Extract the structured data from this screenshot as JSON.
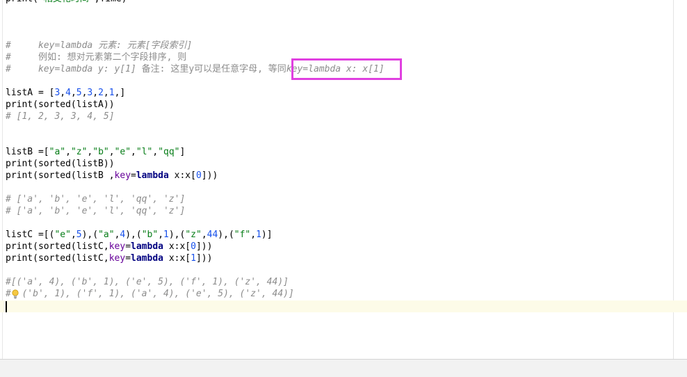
{
  "editor": {
    "lines": [
      {
        "id": "l0",
        "parts": [
          {
            "t": "print(",
            "c": "fn"
          },
          {
            "t": "\"相交花时间\"",
            "c": "str"
          },
          {
            "t": ",Time)",
            "c": "fn"
          }
        ]
      },
      {
        "id": "l1",
        "parts": [
          {
            "t": "#     key=lambda ",
            "c": "cmt"
          },
          {
            "t": "元素: 元素[字段索引]",
            "c": "cmt"
          }
        ]
      },
      {
        "id": "l2",
        "parts": [
          {
            "t": "#     ",
            "c": "cmt"
          },
          {
            "t": "例如: 想对元素第二个字段排序, 则",
            "c": "cmt-cn"
          }
        ]
      },
      {
        "id": "l3",
        "parts": [
          {
            "t": "#     key=lambda y: y[1] ",
            "c": "cmt"
          },
          {
            "t": "备注: 这里y可以是任意字母, 等同",
            "c": "cmt-cn"
          },
          {
            "t": "key=lambda x: x[1]",
            "c": "cmt"
          }
        ]
      },
      {
        "id": "l4",
        "parts": [
          {
            "t": "listA = [",
            "c": "fn"
          },
          {
            "t": "3",
            "c": "num"
          },
          {
            "t": ",",
            "c": "fn"
          },
          {
            "t": "4",
            "c": "num"
          },
          {
            "t": ",",
            "c": "fn"
          },
          {
            "t": "5",
            "c": "num"
          },
          {
            "t": ",",
            "c": "fn"
          },
          {
            "t": "3",
            "c": "num"
          },
          {
            "t": ",",
            "c": "fn"
          },
          {
            "t": "2",
            "c": "num"
          },
          {
            "t": ",",
            "c": "fn"
          },
          {
            "t": "1",
            "c": "num"
          },
          {
            "t": ",]",
            "c": "fn"
          }
        ]
      },
      {
        "id": "l5",
        "parts": [
          {
            "t": "print(sorted(listA))",
            "c": "fn"
          }
        ]
      },
      {
        "id": "l6",
        "parts": [
          {
            "t": "# [1, 2, 3, 3, 4, 5]",
            "c": "cmt"
          }
        ]
      },
      {
        "id": "l7",
        "parts": [
          {
            "t": "listB =[",
            "c": "fn"
          },
          {
            "t": "\"a\"",
            "c": "str"
          },
          {
            "t": ",",
            "c": "fn"
          },
          {
            "t": "\"z\"",
            "c": "str"
          },
          {
            "t": ",",
            "c": "fn"
          },
          {
            "t": "\"b\"",
            "c": "str"
          },
          {
            "t": ",",
            "c": "fn"
          },
          {
            "t": "\"e\"",
            "c": "str"
          },
          {
            "t": ",",
            "c": "fn"
          },
          {
            "t": "\"l\"",
            "c": "str"
          },
          {
            "t": ",",
            "c": "fn"
          },
          {
            "t": "\"qq\"",
            "c": "str"
          },
          {
            "t": "]",
            "c": "fn"
          }
        ]
      },
      {
        "id": "l8",
        "parts": [
          {
            "t": "print(sorted(listB))",
            "c": "fn"
          }
        ]
      },
      {
        "id": "l9",
        "parts": [
          {
            "t": "print(sorted(listB ,",
            "c": "fn"
          },
          {
            "t": "key",
            "c": "param"
          },
          {
            "t": "=",
            "c": "fn"
          },
          {
            "t": "lambda",
            "c": "kw"
          },
          {
            "t": " x:x[",
            "c": "fn"
          },
          {
            "t": "0",
            "c": "num"
          },
          {
            "t": "]))",
            "c": "fn"
          }
        ]
      },
      {
        "id": "l10",
        "parts": [
          {
            "t": "# ['a', 'b', 'e', 'l', 'qq', 'z']",
            "c": "cmt"
          }
        ]
      },
      {
        "id": "l11",
        "parts": [
          {
            "t": "# ['a', 'b', 'e', 'l', 'qq', 'z']",
            "c": "cmt"
          }
        ]
      },
      {
        "id": "l12",
        "parts": [
          {
            "t": "listC =[(",
            "c": "fn"
          },
          {
            "t": "\"e\"",
            "c": "str"
          },
          {
            "t": ",",
            "c": "fn"
          },
          {
            "t": "5",
            "c": "num"
          },
          {
            "t": "),(",
            "c": "fn"
          },
          {
            "t": "\"a\"",
            "c": "str"
          },
          {
            "t": ",",
            "c": "fn"
          },
          {
            "t": "4",
            "c": "num"
          },
          {
            "t": "),(",
            "c": "fn"
          },
          {
            "t": "\"b\"",
            "c": "str"
          },
          {
            "t": ",",
            "c": "fn"
          },
          {
            "t": "1",
            "c": "num"
          },
          {
            "t": "),(",
            "c": "fn"
          },
          {
            "t": "\"z\"",
            "c": "str"
          },
          {
            "t": ",",
            "c": "fn"
          },
          {
            "t": "44",
            "c": "num"
          },
          {
            "t": "),(",
            "c": "fn"
          },
          {
            "t": "\"f\"",
            "c": "str"
          },
          {
            "t": ",",
            "c": "fn"
          },
          {
            "t": "1",
            "c": "num"
          },
          {
            "t": ")]",
            "c": "fn"
          }
        ]
      },
      {
        "id": "l13",
        "parts": [
          {
            "t": "print(sorted(listC,",
            "c": "fn"
          },
          {
            "t": "key",
            "c": "param"
          },
          {
            "t": "=",
            "c": "fn"
          },
          {
            "t": "lambda",
            "c": "kw"
          },
          {
            "t": " x:x[",
            "c": "fn"
          },
          {
            "t": "0",
            "c": "num"
          },
          {
            "t": "]))",
            "c": "fn"
          }
        ]
      },
      {
        "id": "l14",
        "parts": [
          {
            "t": "print(sorted(listC,",
            "c": "fn"
          },
          {
            "t": "key",
            "c": "param"
          },
          {
            "t": "=",
            "c": "fn"
          },
          {
            "t": "lambda",
            "c": "kw"
          },
          {
            "t": " x:x[",
            "c": "fn"
          },
          {
            "t": "1",
            "c": "num"
          },
          {
            "t": "]))",
            "c": "fn"
          }
        ]
      },
      {
        "id": "l15",
        "parts": [
          {
            "t": "#[('a', 4), ('b', 1), ('e', 5), ('f', 1), ('z', 44)]",
            "c": "cmt"
          }
        ]
      },
      {
        "id": "l16",
        "parts": [
          {
            "t": "#  ('b', 1), ('f', 1), ('a', 4), ('e', 5), ('z', 44)]",
            "c": "cmt"
          }
        ]
      }
    ]
  },
  "colors": {
    "highlight_box": "#e040e0",
    "comment": "#8c8c8c",
    "string": "#067d17",
    "keyword": "#000080",
    "param": "#660099",
    "number": "#1750eb",
    "current_line": "#fdfbe8"
  },
  "icons": {
    "intention": "lightbulb-icon"
  }
}
